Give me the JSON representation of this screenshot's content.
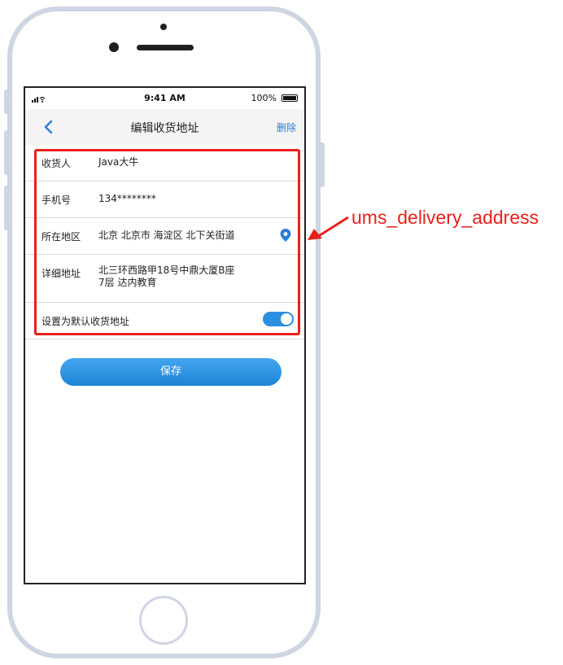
{
  "status_bar": {
    "time": "9:41 AM",
    "battery": "100%"
  },
  "nav": {
    "title": "编辑收货地址",
    "delete_label": "删除",
    "back_icon": "chevron-left-icon"
  },
  "form": {
    "name": {
      "label": "收货人",
      "value": "Java大牛"
    },
    "phone": {
      "label": "手机号",
      "value": "134********"
    },
    "region": {
      "label": "所在地区",
      "value": "北京 北京市 海淀区 北下关街道",
      "icon": "location-pin-icon"
    },
    "address": {
      "label": "详细地址",
      "line1": "北三环西路甲18号中鼎大厦B座",
      "line2": "7层 达内教育"
    },
    "default": {
      "label": "设置为默认收货地址",
      "enabled": true
    }
  },
  "save_label": "保存",
  "annotation": {
    "text": "ums_delivery_address",
    "color": "#e8201c"
  },
  "colors": {
    "accent": "#2d8fe0",
    "annotation": "#e8201c"
  }
}
